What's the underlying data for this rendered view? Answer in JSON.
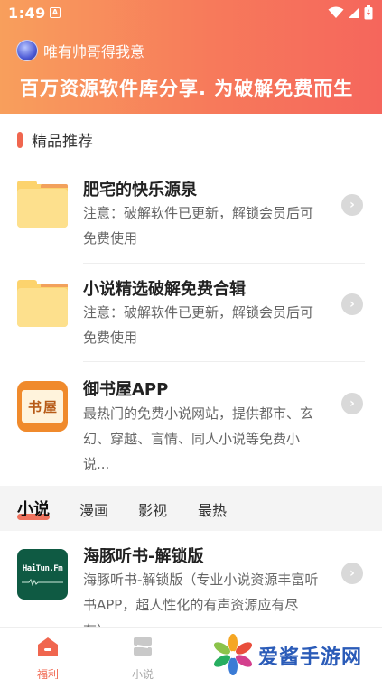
{
  "status_bar": {
    "time": "1:49",
    "notif": "A"
  },
  "header": {
    "username": "唯有帅哥得我意",
    "slogan": "百万资源软件库分享. 为破解免费而生"
  },
  "section": {
    "title": "精品推荐"
  },
  "items": [
    {
      "title": "肥宅的快乐源泉",
      "desc": "注意：破解软件已更新，解锁会员后可免费使用",
      "icon": "folder-icon"
    },
    {
      "title": "小说精选破解免费合辑",
      "desc": "注意：破解软件已更新，解锁会员后可免费使用",
      "icon": "folder-icon"
    },
    {
      "title": "御书屋APP",
      "desc": "最热门的免费小说网站，提供都市、玄幻、穿越、言情、同人小说等免费小说...",
      "icon": "book-house-icon",
      "icon_text": [
        "书",
        "屋"
      ]
    }
  ],
  "tabs": [
    {
      "label": "小说",
      "active": true
    },
    {
      "label": "漫画",
      "active": false
    },
    {
      "label": "影视",
      "active": false
    },
    {
      "label": "最热",
      "active": false
    }
  ],
  "list_item": {
    "title": "海豚听书-解锁版",
    "desc": "海豚听书-解锁版（专业小说资源丰富听书APP，超人性化的有声资源应有尽有）...",
    "icon_text": "HaiTun.Fm"
  },
  "bottom_nav": [
    {
      "label": "福利",
      "icon": "home-icon",
      "active": true
    },
    {
      "label": "小说",
      "icon": "layers-icon",
      "active": false
    }
  ],
  "watermark": {
    "text": "爱酱手游网"
  },
  "colors": {
    "accent": "#f0664f",
    "header_start": "#f89f5c",
    "header_end": "#f5665c"
  }
}
